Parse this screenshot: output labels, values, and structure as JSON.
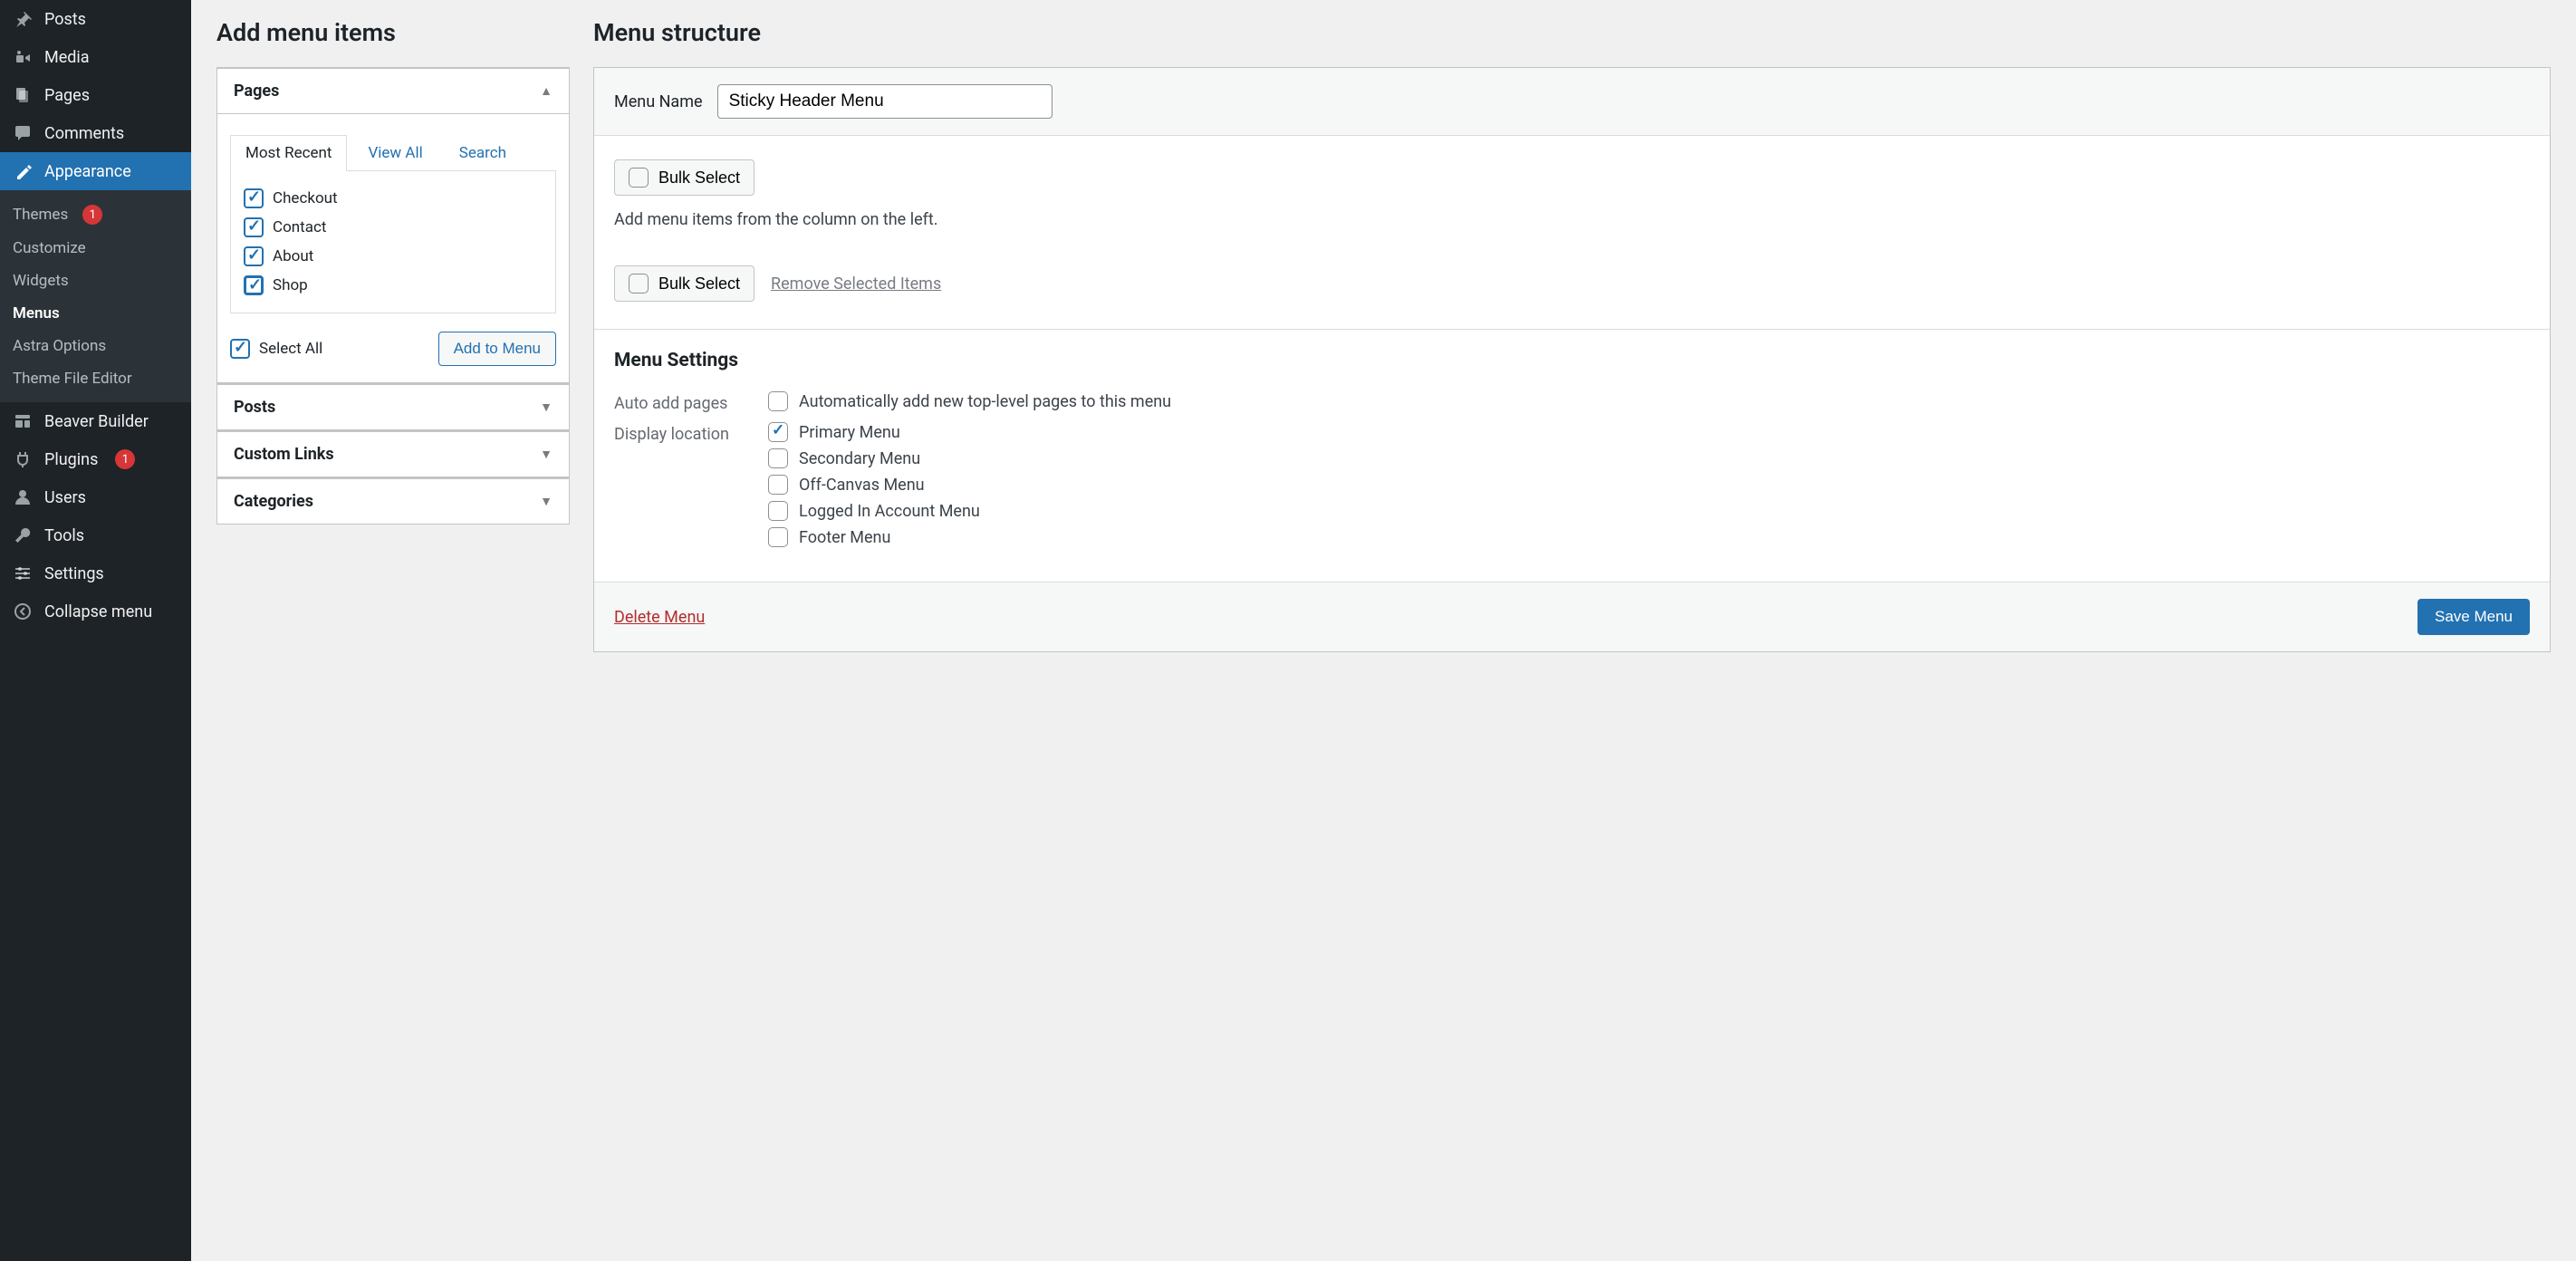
{
  "sidebar": {
    "items": [
      {
        "icon": "pin",
        "label": "Posts"
      },
      {
        "icon": "media",
        "label": "Media"
      },
      {
        "icon": "pages",
        "label": "Pages"
      },
      {
        "icon": "comments",
        "label": "Comments"
      },
      {
        "icon": "appearance",
        "label": "Appearance",
        "active": true
      },
      {
        "icon": "beaver",
        "label": "Beaver Builder"
      },
      {
        "icon": "plugins",
        "label": "Plugins",
        "badge": "1"
      },
      {
        "icon": "users",
        "label": "Users"
      },
      {
        "icon": "tools",
        "label": "Tools"
      },
      {
        "icon": "settings",
        "label": "Settings"
      },
      {
        "icon": "collapse",
        "label": "Collapse menu"
      }
    ],
    "appearance_sub": [
      {
        "label": "Themes",
        "badge": "1"
      },
      {
        "label": "Customize"
      },
      {
        "label": "Widgets"
      },
      {
        "label": "Menus",
        "current": true
      },
      {
        "label": "Astra Options"
      },
      {
        "label": "Theme File Editor"
      }
    ]
  },
  "left": {
    "title": "Add menu items",
    "pages_label": "Pages",
    "tabs": {
      "most_recent": "Most Recent",
      "view_all": "View All",
      "search": "Search"
    },
    "page_items": [
      {
        "label": "Checkout",
        "checked": true
      },
      {
        "label": "Contact",
        "checked": true
      },
      {
        "label": "About",
        "checked": true
      },
      {
        "label": "Shop",
        "checked": true,
        "focus": true
      }
    ],
    "select_all": "Select All",
    "add_to_menu": "Add to Menu",
    "posts_label": "Posts",
    "custom_links_label": "Custom Links",
    "categories_label": "Categories"
  },
  "right": {
    "title": "Menu structure",
    "menu_name_label": "Menu Name",
    "menu_name_value": "Sticky Header Menu",
    "bulk_select": "Bulk Select",
    "hint": "Add menu items from the column on the left.",
    "remove_selected": "Remove Selected Items",
    "menu_settings_title": "Menu Settings",
    "auto_add_label": "Auto add pages",
    "auto_add_option": "Automatically add new top-level pages to this menu",
    "display_location_label": "Display location",
    "locations": [
      {
        "label": "Primary Menu",
        "checked": true
      },
      {
        "label": "Secondary Menu",
        "checked": false
      },
      {
        "label": "Off-Canvas Menu",
        "checked": false
      },
      {
        "label": "Logged In Account Menu",
        "checked": false
      },
      {
        "label": "Footer Menu",
        "checked": false
      }
    ],
    "delete_menu": "Delete Menu",
    "save_menu": "Save Menu"
  }
}
